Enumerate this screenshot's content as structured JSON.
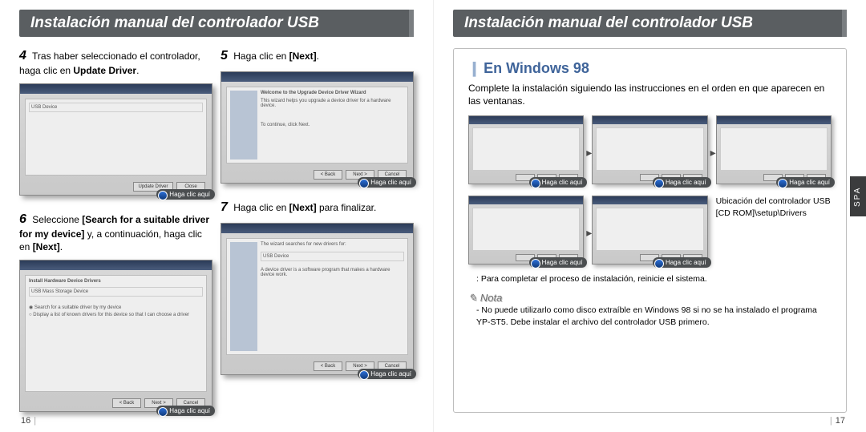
{
  "left": {
    "title": "Instalación manual del controlador USB",
    "steps": {
      "s4": {
        "num": "4",
        "text_a": "Tras haber seleccionado el controlador, haga clic en ",
        "text_b_bold": "Update Driver",
        "text_c": "."
      },
      "s5": {
        "num": "5",
        "text_a": "Haga clic en ",
        "text_b_bold": "[Next]",
        "text_c": "."
      },
      "s6": {
        "num": "6",
        "text_a": "Seleccione ",
        "text_b_bold": "[Search for a suitable driver for my device]",
        "text_c": " y, a continuación, haga clic en ",
        "text_d_bold": "[Next]",
        "text_e": "."
      },
      "s7": {
        "num": "7",
        "text_a": "Haga clic en ",
        "text_b_bold": "[Next]",
        "text_c": " para finalizar."
      }
    },
    "caption": "Haga clic aquí",
    "mock": {
      "win1_line1": "USB Device",
      "win1_btn1": "Update Driver",
      "win2_title": "Welcome to the Upgrade Device Driver Wizard",
      "win2_line1": "This wizard helps you upgrade a device driver for a hardware device.",
      "win2_line2": "To continue, click Next.",
      "win3_title": "Install Hardware Device Drivers",
      "win3_line1": "USB Mass Storage Device",
      "win4_line1": "USB Device",
      "btn_back": "< Back",
      "btn_next": "Next >",
      "btn_cancel": "Cancel",
      "btn_close": "Close"
    },
    "pagenum": "16"
  },
  "right": {
    "title": "Instalación manual del controlador USB",
    "heading": "En Windows 98",
    "intro": "Complete la instalación siguiendo las instrucciones en el orden en que aparecen en las ventanas.",
    "caption": "Haga clic aquí",
    "loc_line1": "Ubicación del controlador USB",
    "loc_line2": "[CD ROM]\\setup\\Drivers",
    "footnote": ": Para completar el proceso de instalación, reinicie el sistema.",
    "nota_label": "Nota",
    "nota_text": "- No puede utilizarlo como disco extraíble en Windows 98 si no se ha instalado el programa YP-ST5. Debe instalar el archivo del controlador USB primero.",
    "pagenum": "17",
    "sidetab": "SPA"
  }
}
